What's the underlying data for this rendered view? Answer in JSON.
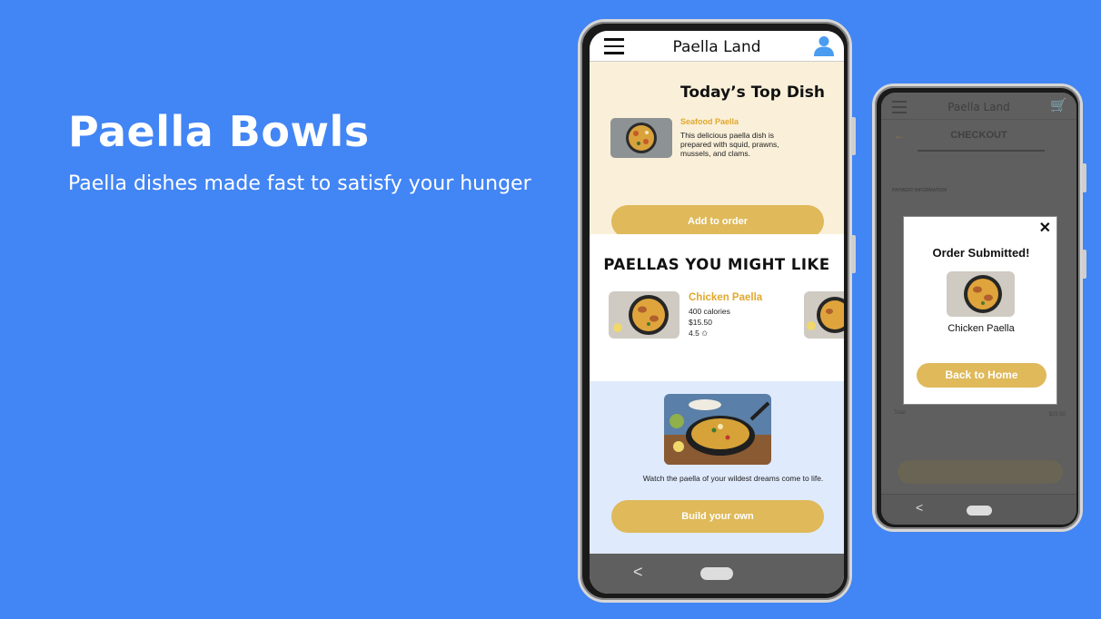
{
  "hero": {
    "title": "Paella Bowls",
    "subtitle": "Paella dishes made fast to satisfy your hunger"
  },
  "phone_main": {
    "header": {
      "brand": "Paella Land",
      "menu_icon": "hamburger-menu-icon",
      "account_icon": "user-icon"
    },
    "top_dish": {
      "heading": "Today’s Top Dish",
      "name": "Seafood Paella",
      "description": "This delicious paella dish is prepared with squid, prawns, mussels, and clams.",
      "button": "Add to order"
    },
    "recommendations": {
      "heading": "PAELLAS YOU MIGHT LIKE",
      "items": [
        {
          "name": "Chicken Paella",
          "calories": "400 calories",
          "price": "$15.50",
          "rating": "4.5 ✩"
        }
      ]
    },
    "build": {
      "caption": "Watch the paella of your wildest dreams come to life.",
      "button": "Build your own"
    },
    "nav": {
      "back": "<"
    }
  },
  "phone_checkout": {
    "header": {
      "brand": "Paella Land",
      "cart_icon": "cart-icon"
    },
    "title": "CHECKOUT",
    "back_arrow": "←",
    "payment_label": "PAYMENT INFORMATION",
    "total_label": "Total",
    "total_value": "$25.50",
    "modal": {
      "close": "✕",
      "title": "Order Submitted!",
      "item": "Chicken Paella",
      "button": "Back to Home"
    },
    "nav": {
      "back": "<"
    }
  },
  "colors": {
    "background": "#4285f4",
    "accent_gold": "#dfb95a",
    "dish_name": "#e0a82e",
    "top_dish_bg": "#faf0d9",
    "build_bg": "#dfeafc"
  }
}
